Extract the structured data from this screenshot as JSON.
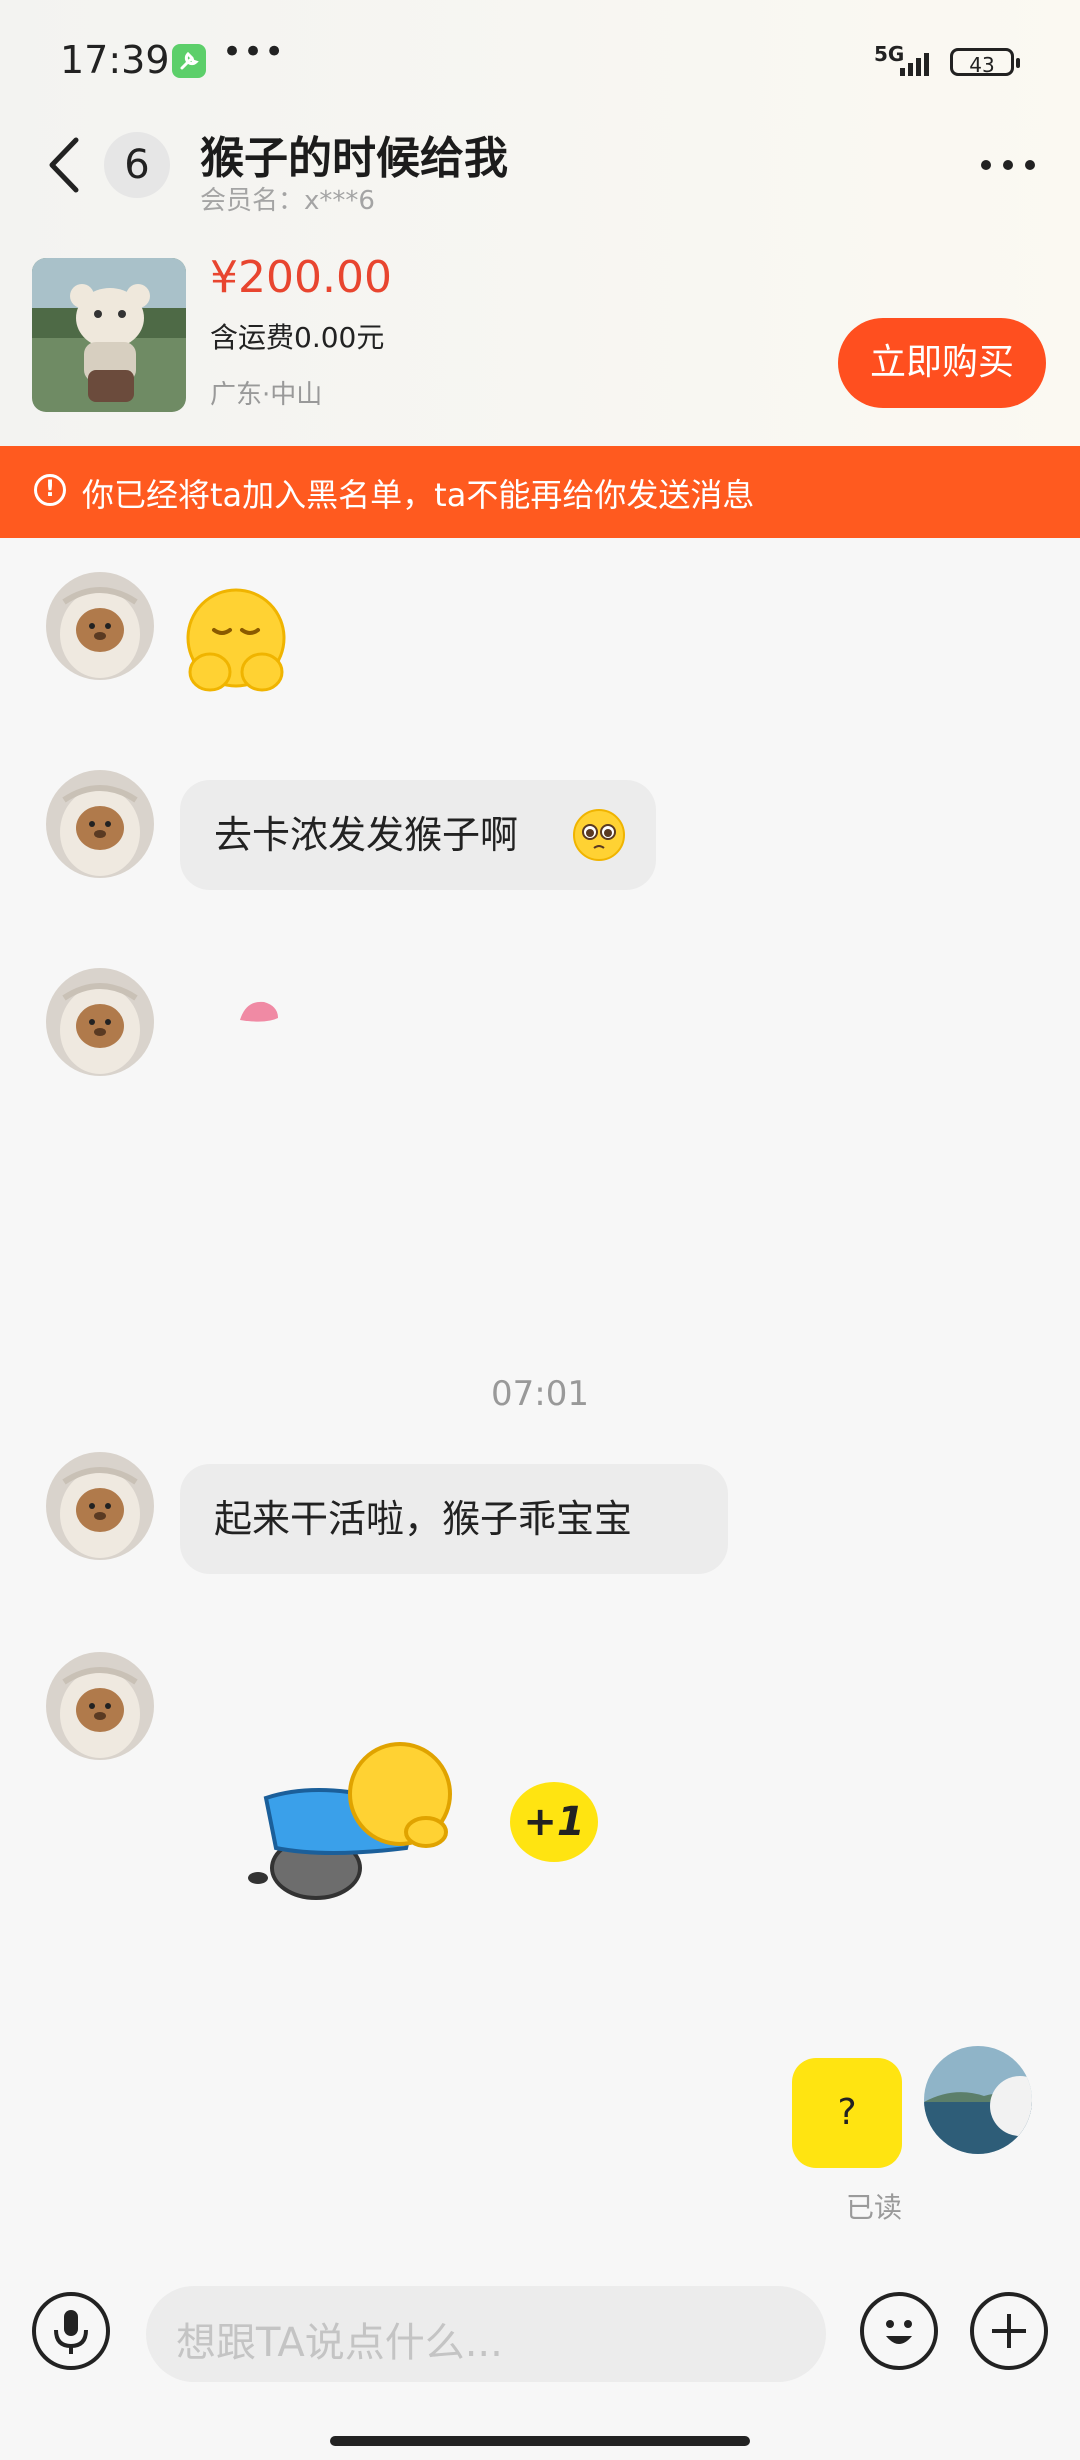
{
  "status_bar": {
    "time": "17:39",
    "more": "•••",
    "network": "5G",
    "battery": "43"
  },
  "header": {
    "unread_count": "6",
    "title": "猴子的时候给我",
    "member": "会员名：x***6"
  },
  "product": {
    "price": "¥200.00",
    "shipping": "含运费0.00元",
    "location": "广东·中山",
    "buy_label": "立即购买"
  },
  "banner": {
    "icon": "!",
    "text": "你已经将ta加入黑名单，ta不能再给你发送消息"
  },
  "messages": {
    "m2": "去卡浓发发猴子啊",
    "timestamp": "07:01",
    "m4": "起来干活啦，猴子乖宝宝",
    "plus_one": "+1",
    "sent": "?",
    "read_status": "已读"
  },
  "input": {
    "placeholder": "想跟TA说点什么..."
  },
  "colors": {
    "accent": "#ff5a1f",
    "price": "#e8452f",
    "sent_bubble": "#ffe411"
  }
}
